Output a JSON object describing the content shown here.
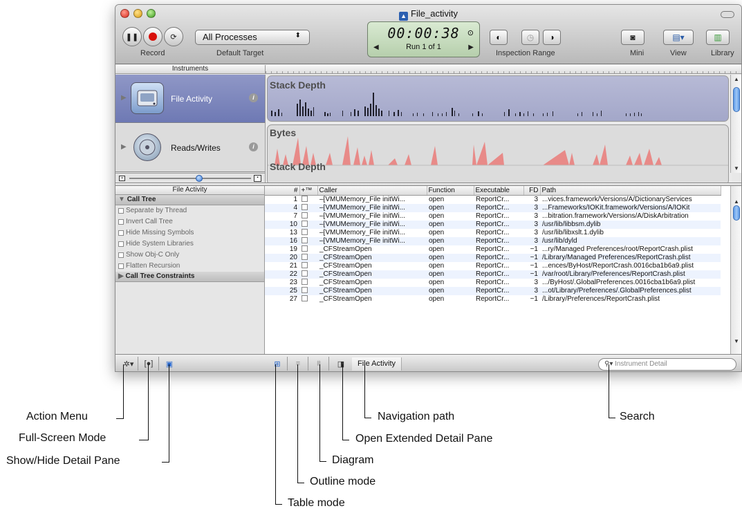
{
  "window": {
    "title": "File_activity",
    "record_label": "Record",
    "target_popup": "All Processes",
    "target_label": "Default Target",
    "timer": "00:00:38",
    "run": "Run 1 of 1",
    "inspection_label": "Inspection Range",
    "mini_label": "Mini",
    "view_label": "View",
    "library_label": "Library"
  },
  "instruments": {
    "header": "Instruments",
    "items": [
      {
        "name": "File Activity",
        "info": "i"
      },
      {
        "name": "Reads/Writes",
        "info": "i"
      }
    ]
  },
  "tracks": {
    "t1_title": "Stack Depth",
    "t2_title": "Bytes",
    "t2_subtitle": "Stack Depth"
  },
  "detail": {
    "header": "File Activity",
    "call_tree": "Call Tree",
    "options": [
      "Separate by Thread",
      "Invert Call Tree",
      "Hide Missing Symbols",
      "Hide System Libraries",
      "Show Obj-C Only",
      "Flatten Recursion"
    ],
    "constraints": "Call Tree Constraints"
  },
  "table": {
    "columns": [
      "#",
      "+™",
      "Caller",
      "Function",
      "Executable",
      "FD",
      "Path"
    ],
    "rows": [
      {
        "n": "1",
        "caller": "–[VMUMemory_File initWi...",
        "fn": "open",
        "exe": "ReportCr...",
        "fd": "3",
        "path": "...vices.framework/Versions/A/DictionaryServices"
      },
      {
        "n": "4",
        "caller": "–[VMUMemory_File initWi...",
        "fn": "open",
        "exe": "ReportCr...",
        "fd": "3",
        "path": "...Frameworks/IOKit.framework/Versions/A/IOKit"
      },
      {
        "n": "7",
        "caller": "–[VMUMemory_File initWi...",
        "fn": "open",
        "exe": "ReportCr...",
        "fd": "3",
        "path": "...bitration.framework/Versions/A/DiskArbitration"
      },
      {
        "n": "10",
        "caller": "–[VMUMemory_File initWi...",
        "fn": "open",
        "exe": "ReportCr...",
        "fd": "3",
        "path": "/usr/lib/libbsm.dylib"
      },
      {
        "n": "13",
        "caller": "–[VMUMemory_File initWi...",
        "fn": "open",
        "exe": "ReportCr...",
        "fd": "3",
        "path": "/usr/lib/libxslt.1.dylib"
      },
      {
        "n": "16",
        "caller": "–[VMUMemory_File initWi...",
        "fn": "open",
        "exe": "ReportCr...",
        "fd": "3",
        "path": "/usr/lib/dyld"
      },
      {
        "n": "19",
        "caller": "_CFStreamOpen",
        "fn": "open",
        "exe": "ReportCr...",
        "fd": "−1",
        "path": "...ry/Managed Preferences/root/ReportCrash.plist"
      },
      {
        "n": "20",
        "caller": "_CFStreamOpen",
        "fn": "open",
        "exe": "ReportCr...",
        "fd": "−1",
        "path": "/Library/Managed Preferences/ReportCrash.plist"
      },
      {
        "n": "21",
        "caller": "_CFStreamOpen",
        "fn": "open",
        "exe": "ReportCr...",
        "fd": "−1",
        "path": "...ences/ByHost/ReportCrash.0016cba1b6a9.plist"
      },
      {
        "n": "22",
        "caller": "_CFStreamOpen",
        "fn": "open",
        "exe": "ReportCr...",
        "fd": "−1",
        "path": "/var/root/Library/Preferences/ReportCrash.plist"
      },
      {
        "n": "23",
        "caller": "_CFStreamOpen",
        "fn": "open",
        "exe": "ReportCr...",
        "fd": "3",
        "path": ".../ByHost/.GlobalPreferences.0016cba1b6a9.plist"
      },
      {
        "n": "25",
        "caller": "_CFStreamOpen",
        "fn": "open",
        "exe": "ReportCr...",
        "fd": "3",
        "path": "...ot/Library/Preferences/.GlobalPreferences.plist"
      },
      {
        "n": "27",
        "caller": "_CFStreamOpen",
        "fn": "open",
        "exe": "ReportCr...",
        "fd": "−1",
        "path": "/Library/Preferences/ReportCrash.plist"
      }
    ]
  },
  "bottombar": {
    "crumb": "File Activity",
    "search_placeholder": "Instrument Detail"
  },
  "callouts": {
    "action_menu": "Action Menu",
    "full_screen": "Full-Screen Mode",
    "show_hide_detail": "Show/Hide Detail Pane",
    "navigation_path": "Navigation path",
    "open_extended": "Open Extended Detail Pane",
    "diagram": "Diagram",
    "outline_mode": "Outline mode",
    "table_mode": "Table mode",
    "search": "Search"
  },
  "colors": {
    "selected_instrument": "#7d86bd",
    "bytes_fill": "#e88a88",
    "record_red": "#d8100a",
    "accent_blue": "#3579d6"
  }
}
